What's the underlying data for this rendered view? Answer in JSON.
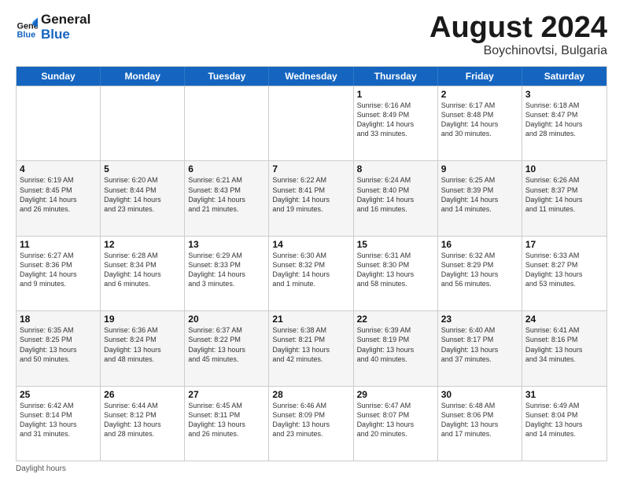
{
  "logo": {
    "line1": "General",
    "line2": "Blue"
  },
  "header": {
    "month": "August 2024",
    "location": "Boychinovtsi, Bulgaria"
  },
  "days": [
    "Sunday",
    "Monday",
    "Tuesday",
    "Wednesday",
    "Thursday",
    "Friday",
    "Saturday"
  ],
  "rows": [
    [
      {
        "day": "",
        "text": ""
      },
      {
        "day": "",
        "text": ""
      },
      {
        "day": "",
        "text": ""
      },
      {
        "day": "",
        "text": ""
      },
      {
        "day": "1",
        "text": "Sunrise: 6:16 AM\nSunset: 8:49 PM\nDaylight: 14 hours\nand 33 minutes."
      },
      {
        "day": "2",
        "text": "Sunrise: 6:17 AM\nSunset: 8:48 PM\nDaylight: 14 hours\nand 30 minutes."
      },
      {
        "day": "3",
        "text": "Sunrise: 6:18 AM\nSunset: 8:47 PM\nDaylight: 14 hours\nand 28 minutes."
      }
    ],
    [
      {
        "day": "4",
        "text": "Sunrise: 6:19 AM\nSunset: 8:45 PM\nDaylight: 14 hours\nand 26 minutes."
      },
      {
        "day": "5",
        "text": "Sunrise: 6:20 AM\nSunset: 8:44 PM\nDaylight: 14 hours\nand 23 minutes."
      },
      {
        "day": "6",
        "text": "Sunrise: 6:21 AM\nSunset: 8:43 PM\nDaylight: 14 hours\nand 21 minutes."
      },
      {
        "day": "7",
        "text": "Sunrise: 6:22 AM\nSunset: 8:41 PM\nDaylight: 14 hours\nand 19 minutes."
      },
      {
        "day": "8",
        "text": "Sunrise: 6:24 AM\nSunset: 8:40 PM\nDaylight: 14 hours\nand 16 minutes."
      },
      {
        "day": "9",
        "text": "Sunrise: 6:25 AM\nSunset: 8:39 PM\nDaylight: 14 hours\nand 14 minutes."
      },
      {
        "day": "10",
        "text": "Sunrise: 6:26 AM\nSunset: 8:37 PM\nDaylight: 14 hours\nand 11 minutes."
      }
    ],
    [
      {
        "day": "11",
        "text": "Sunrise: 6:27 AM\nSunset: 8:36 PM\nDaylight: 14 hours\nand 9 minutes."
      },
      {
        "day": "12",
        "text": "Sunrise: 6:28 AM\nSunset: 8:34 PM\nDaylight: 14 hours\nand 6 minutes."
      },
      {
        "day": "13",
        "text": "Sunrise: 6:29 AM\nSunset: 8:33 PM\nDaylight: 14 hours\nand 3 minutes."
      },
      {
        "day": "14",
        "text": "Sunrise: 6:30 AM\nSunset: 8:32 PM\nDaylight: 14 hours\nand 1 minute."
      },
      {
        "day": "15",
        "text": "Sunrise: 6:31 AM\nSunset: 8:30 PM\nDaylight: 13 hours\nand 58 minutes."
      },
      {
        "day": "16",
        "text": "Sunrise: 6:32 AM\nSunset: 8:29 PM\nDaylight: 13 hours\nand 56 minutes."
      },
      {
        "day": "17",
        "text": "Sunrise: 6:33 AM\nSunset: 8:27 PM\nDaylight: 13 hours\nand 53 minutes."
      }
    ],
    [
      {
        "day": "18",
        "text": "Sunrise: 6:35 AM\nSunset: 8:25 PM\nDaylight: 13 hours\nand 50 minutes."
      },
      {
        "day": "19",
        "text": "Sunrise: 6:36 AM\nSunset: 8:24 PM\nDaylight: 13 hours\nand 48 minutes."
      },
      {
        "day": "20",
        "text": "Sunrise: 6:37 AM\nSunset: 8:22 PM\nDaylight: 13 hours\nand 45 minutes."
      },
      {
        "day": "21",
        "text": "Sunrise: 6:38 AM\nSunset: 8:21 PM\nDaylight: 13 hours\nand 42 minutes."
      },
      {
        "day": "22",
        "text": "Sunrise: 6:39 AM\nSunset: 8:19 PM\nDaylight: 13 hours\nand 40 minutes."
      },
      {
        "day": "23",
        "text": "Sunrise: 6:40 AM\nSunset: 8:17 PM\nDaylight: 13 hours\nand 37 minutes."
      },
      {
        "day": "24",
        "text": "Sunrise: 6:41 AM\nSunset: 8:16 PM\nDaylight: 13 hours\nand 34 minutes."
      }
    ],
    [
      {
        "day": "25",
        "text": "Sunrise: 6:42 AM\nSunset: 8:14 PM\nDaylight: 13 hours\nand 31 minutes."
      },
      {
        "day": "26",
        "text": "Sunrise: 6:44 AM\nSunset: 8:12 PM\nDaylight: 13 hours\nand 28 minutes."
      },
      {
        "day": "27",
        "text": "Sunrise: 6:45 AM\nSunset: 8:11 PM\nDaylight: 13 hours\nand 26 minutes."
      },
      {
        "day": "28",
        "text": "Sunrise: 6:46 AM\nSunset: 8:09 PM\nDaylight: 13 hours\nand 23 minutes."
      },
      {
        "day": "29",
        "text": "Sunrise: 6:47 AM\nSunset: 8:07 PM\nDaylight: 13 hours\nand 20 minutes."
      },
      {
        "day": "30",
        "text": "Sunrise: 6:48 AM\nSunset: 8:06 PM\nDaylight: 13 hours\nand 17 minutes."
      },
      {
        "day": "31",
        "text": "Sunrise: 6:49 AM\nSunset: 8:04 PM\nDaylight: 13 hours\nand 14 minutes."
      }
    ]
  ],
  "footer": {
    "note": "Daylight hours"
  }
}
